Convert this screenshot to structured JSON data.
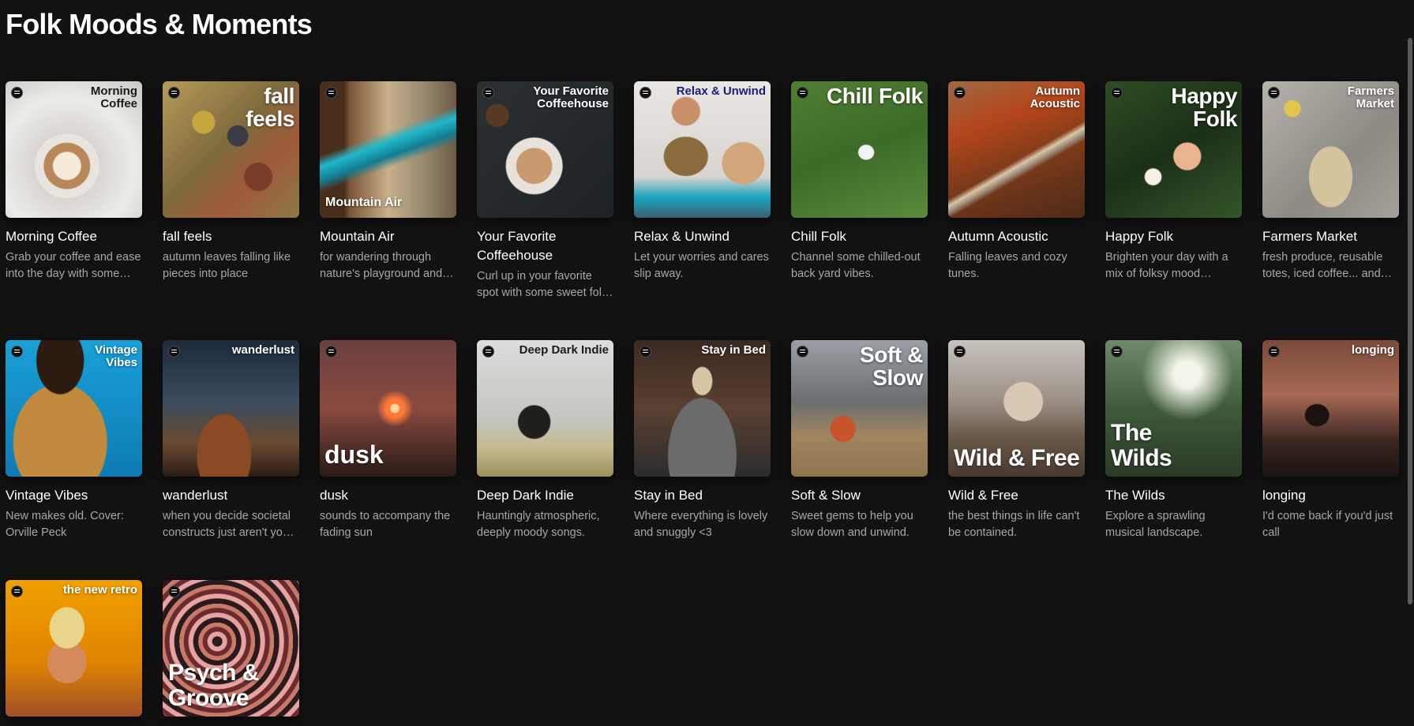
{
  "page": {
    "title": "Folk Moods & Moments"
  },
  "colors": {
    "background": "#121212",
    "text_primary": "#ffffff",
    "text_secondary": "#a7a7a7"
  },
  "playlists": [
    {
      "title": "Morning Coffee",
      "cover_text": "Morning\nCoffee",
      "description": "Grab your coffee and ease into the day with some feel-good folk.",
      "bg": "radial-gradient(circle at 45% 62%, #f6ead9 0 12%, #b8885a 13% 20%, #e9e4de 21% 28%, #d9d6d2 29%, #ecebe8 60%, #c9c7c3 100%)",
      "pos": "ot-tr",
      "dark_text": true
    },
    {
      "title": "fall feels",
      "cover_text": "fall\nfeels",
      "description": "autumn leaves falling like pieces into place",
      "bg": "radial-gradient(circle at 30% 30%, #c8a640 0 8%, transparent 9%), radial-gradient(circle at 70% 70%, #7a3d2a 0 10%, transparent 11%), radial-gradient(circle at 55% 40%, #3b3b45 0 9%, transparent 10%), linear-gradient(135deg, #b79b58, #7e6b3d 45%, #a05a3a 70%, #8a7a45)",
      "pos": "ot-tr-big"
    },
    {
      "title": "Mountain Air",
      "cover_text": "Mountain Air",
      "description": "for wandering through nature's playground and enjoying the view.",
      "bg": "linear-gradient(160deg, transparent 40%, #1fb7c9 46%, #137c91 54%, transparent 60%), linear-gradient(90deg, #4a2e1c 0 18%, #7c5538 22%, #c7b08a 50%, #9a8b72 75%, #6c5a44)",
      "pos": "ot-bl"
    },
    {
      "title": "Your Favorite Coffeehouse",
      "cover_text": "Your Favorite\nCoffeehouse",
      "description": "Curl up in your favorite spot with some sweet folk tunes.",
      "bg": "radial-gradient(circle at 42% 62%, #c99a6d 0 15%, #e9e2da 16% 24%, transparent 25%), radial-gradient(circle at 15% 25%, #5a3a22 0 7%, transparent 8%), linear-gradient(135deg, #2b3033, #1d2225)",
      "pos": "ot-tr"
    },
    {
      "title": "Relax & Unwind",
      "cover_text": "Relax & Unwind",
      "description": "Let your worries and cares slip away.",
      "bg": "radial-gradient(circle at 38% 22%, #c79068 0 10%, transparent 11%), radial-gradient(ellipse at 38% 55%, #8b6a3e 0 18%, transparent 19%), radial-gradient(circle at 80% 60%, #d0a67a 0 15%, transparent 16%), linear-gradient(180deg, #e9e6e3, #d8d4cf 70%, #1aa3bd 85%, #3b5f74)",
      "pos": "ot-tr",
      "dark_text": true,
      "accent": "#1a1b7a"
    },
    {
      "title": "Chill Folk",
      "cover_text": "Chill Folk",
      "description": "Channel some chilled-out back yard vibes.",
      "bg": "radial-gradient(ellipse at 55% 52%, #f2f2f2 0 7%, transparent 8%), linear-gradient(160deg, #4f7f33, #3c6b28 50%, #5a8a3a)",
      "pos": "ot-tr-big"
    },
    {
      "title": "Autumn Acoustic",
      "cover_text": "Autumn\nAcoustic",
      "description": "Falling leaves and cozy tunes.",
      "bg": "linear-gradient(150deg, transparent 55%, #d8c5a8 58%, #9a8a78 61%, transparent 64%), linear-gradient(160deg, #9c6a45, #b4461b 30%, #7b3a1a 60%, #4c2a18)",
      "pos": "ot-tr"
    },
    {
      "title": "Happy Folk",
      "cover_text": "Happy\nFolk",
      "description": "Brighten your day with a mix of folksy mood boosters.",
      "bg": "radial-gradient(circle at 60% 55%, #e8b38e 0 12%, transparent 13%), radial-gradient(circle at 35% 70%, #f3f1e8 0 6%, transparent 7%), linear-gradient(150deg, #2d4d22, #1c2f17 50%, #33562a)",
      "pos": "ot-tr-big"
    },
    {
      "title": "Farmers Market",
      "cover_text": "Farmers\nMarket",
      "description": "fresh produce, reusable totes, iced coffee... and good tunes.",
      "bg": "radial-gradient(ellipse at 50% 70%, #d6c49c 0 22%, transparent 23%), radial-gradient(circle at 22% 20%, #e2c54a 0 5%, transparent 6%), linear-gradient(135deg, #b6b3ad, #8d8a84 60%, #a4a19b)",
      "pos": "ot-tr"
    },
    {
      "title": "Vintage Vibes",
      "cover_text": "Vintage\nVibes",
      "description": "New makes old. Cover: Orville Peck",
      "bg": "radial-gradient(ellipse at 40% 15%, #2d1a10 0 20%, transparent 21%), radial-gradient(ellipse at 40% 75%, #c18a3c 0 40%, transparent 41%), linear-gradient(180deg, #1aa0d8, #0e7bb3)",
      "pos": "ot-tr"
    },
    {
      "title": "wanderlust",
      "cover_text": "wanderlust",
      "description": "when you decide societal constructs just aren't your thing.",
      "bg": "radial-gradient(ellipse at 45% 85%, #8a4a24 0 25%, transparent 26%), linear-gradient(180deg, #1c2a3a, #3a4c5e 45%, #6b4a32 75%, #2a1d15)",
      "pos": "ot-tr"
    },
    {
      "title": "dusk",
      "cover_text": "dusk",
      "description": "sounds to accompany the fading sun",
      "bg": "radial-gradient(circle at 55% 50%, #ffd7a0 0 4%, #ff7a3a 5% 9%, transparent 18%), linear-gradient(180deg, #6a4140, #8a4a3f 50%, #2a1a18)",
      "pos": "ot-bl-huge"
    },
    {
      "title": "Deep Dark Indie",
      "cover_text": "Deep Dark Indie",
      "description": "Hauntingly atmospheric, deeply moody songs.",
      "bg": "radial-gradient(ellipse at 42% 60%, #1f1f1c 0 14%, transparent 15%), linear-gradient(180deg, #dcdedd, #c2c4be 60%, #c5b88a 80%, #9a8f5f)",
      "pos": "ot-tr",
      "dark_text": true
    },
    {
      "title": "Stay in Bed",
      "cover_text": "Stay in Bed",
      "description": "Where everything is lovely and snuggly <3",
      "bg": "radial-gradient(ellipse at 50% 30%, #d6c6a4 0 10%, transparent 11%), radial-gradient(ellipse at 50% 85%, #6b6b6b 0 35%, transparent 36%), linear-gradient(180deg, #3b2a22, #5a4030 50%, #2c2c2c)",
      "pos": "ot-tr"
    },
    {
      "title": "Soft & Slow",
      "cover_text": "Soft &\nSlow",
      "description": "Sweet gems to help you slow down and unwind.",
      "bg": "radial-gradient(ellipse at 38% 65%, #c7542a 0 10%, transparent 11%), linear-gradient(180deg, #9aa0a6, #6a6e70 45%, #a08560 70%, #8d7550)",
      "pos": "ot-tr-big"
    },
    {
      "title": "Wild & Free",
      "cover_text": "Wild & Free",
      "description": "the best things in life can't be contained.",
      "bg": "radial-gradient(ellipse at 55% 45%, #d9c8b4 0 18%, transparent 19%), linear-gradient(180deg, #c8c3bd, #9a8f86 45%, #6a5a4a 70%, #4a3a2e)",
      "pos": "ot-bl-big"
    },
    {
      "title": "The Wilds",
      "cover_text": "The\nWilds",
      "description": "Explore a sprawling musical landscape.",
      "bg": "radial-gradient(circle at 60% 25%, #f3f5ea 0 10%, transparent 35%), linear-gradient(180deg, #6f8a6a, #3f5a3a 50%, #2a3a26)",
      "pos": "ot-bl-big"
    },
    {
      "title": "longing",
      "cover_text": "longing",
      "description": "I'd come back if you'd just call",
      "bg": "radial-gradient(ellipse at 40% 55%, #1a1210 0 10%, transparent 11%), linear-gradient(180deg, #7a4a3a, #a86a54 40%, #3a2420 75%, #1a1412)",
      "pos": "ot-tr"
    },
    {
      "title": "",
      "cover_text": "the new retro",
      "description": "",
      "bg": "radial-gradient(ellipse at 45% 35%, #e8d58a 0 16%, transparent 17%), radial-gradient(ellipse at 45% 60%, #d48a5a 0 18%, transparent 19%), linear-gradient(180deg, #f0a000, #e08400 60%, #a0502a)",
      "pos": "ot-tr"
    },
    {
      "title": "",
      "cover_text": "Psych &\nGroove",
      "description": "",
      "bg": "repeating-radial-gradient(circle at 40% 45%, #2a1a1e 0 6px, #e7a3a0 7px 12px, #6b2a2e 13px 18px, #c77a6a 19px 24px)",
      "pos": "ot-bl-big"
    }
  ]
}
